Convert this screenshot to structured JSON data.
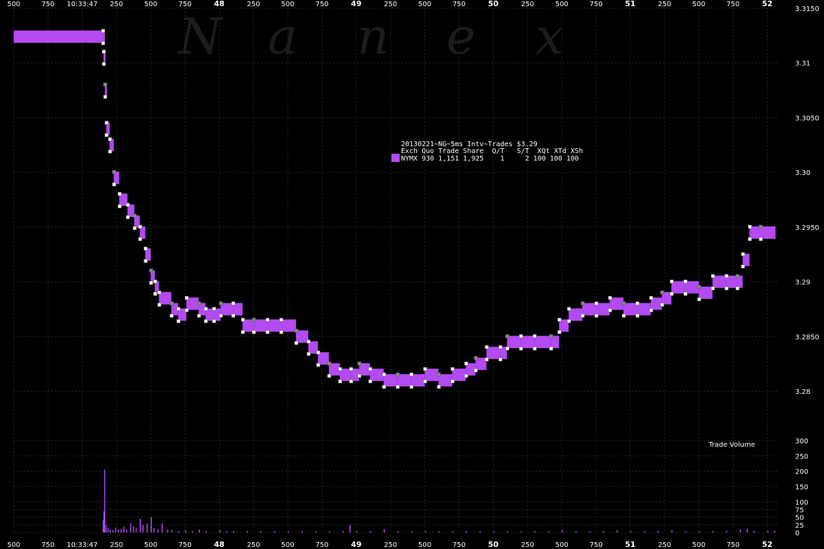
{
  "watermark": [
    "N",
    "a",
    "n",
    "e",
    "x"
  ],
  "legend": {
    "line1": "20130221~NG~5ms Intv~Trades $3.29",
    "line2": "Exch Quo Trade Share  Q/T   S/T  XQt XTd XSh",
    "line3": "NYMX 930 1,151 1,925    1     2 100 100 100"
  },
  "volume_title": "Trade Volume",
  "colors": {
    "background": "#000000",
    "series": "#b44af2",
    "grid": "#2a2a2a",
    "text": "#ffffff",
    "marker": "#ffffff",
    "marker_dark": "#888888"
  },
  "chart_data": {
    "type": "line",
    "title": "20130221~NG~5ms Intv~Trades $3.29",
    "xlabel": "",
    "ylabel": "",
    "x_unit": "ms from 10:33:47.000",
    "x_range": [
      -500,
      5088
    ],
    "x_ticks": [
      {
        "x": -500,
        "label": "500"
      },
      {
        "x": -250,
        "label": "750"
      },
      {
        "x": 0,
        "label": "10:33:47"
      },
      {
        "x": 250,
        "label": "250"
      },
      {
        "x": 500,
        "label": "500"
      },
      {
        "x": 750,
        "label": "750"
      },
      {
        "x": 1000,
        "label": "48"
      },
      {
        "x": 1250,
        "label": "250"
      },
      {
        "x": 1500,
        "label": "500"
      },
      {
        "x": 1750,
        "label": "750"
      },
      {
        "x": 2000,
        "label": "49"
      },
      {
        "x": 2250,
        "label": "250"
      },
      {
        "x": 2500,
        "label": "500"
      },
      {
        "x": 2750,
        "label": "750"
      },
      {
        "x": 3000,
        "label": "50"
      },
      {
        "x": 3250,
        "label": "250"
      },
      {
        "x": 3500,
        "label": "500"
      },
      {
        "x": 3750,
        "label": "750"
      },
      {
        "x": 4000,
        "label": "51"
      },
      {
        "x": 4250,
        "label": "250"
      },
      {
        "x": 4500,
        "label": "500"
      },
      {
        "x": 4750,
        "label": "750"
      },
      {
        "x": 5000,
        "label": "52"
      }
    ],
    "bold_x_ticks": [
      "48",
      "49",
      "50",
      "51",
      "52"
    ],
    "y_range": [
      3.2775,
      3.315
    ],
    "y_ticks": [
      {
        "y": 3.315,
        "label": "3.3150"
      },
      {
        "y": 3.31,
        "label": "3.31"
      },
      {
        "y": 3.305,
        "label": "3.3050"
      },
      {
        "y": 3.3,
        "label": "3.30"
      },
      {
        "y": 3.295,
        "label": "3.2950"
      },
      {
        "y": 3.29,
        "label": "3.29"
      },
      {
        "y": 3.285,
        "label": "3.2850"
      },
      {
        "y": 3.28,
        "label": "3.28"
      }
    ],
    "grid": true,
    "legend_position": "center",
    "series": [
      {
        "name": "NYMX",
        "values": [
          {
            "x": -500,
            "y": 3.3124
          },
          {
            "x": 150,
            "y": 3.3124
          },
          {
            "x": 155,
            "y": 3.3105
          },
          {
            "x": 165,
            "y": 3.3075
          },
          {
            "x": 175,
            "y": 3.304
          },
          {
            "x": 200,
            "y": 3.3025
          },
          {
            "x": 230,
            "y": 3.2995
          },
          {
            "x": 270,
            "y": 3.2975
          },
          {
            "x": 330,
            "y": 3.2965
          },
          {
            "x": 380,
            "y": 3.2955
          },
          {
            "x": 420,
            "y": 3.2945
          },
          {
            "x": 460,
            "y": 3.2925
          },
          {
            "x": 500,
            "y": 3.2905
          },
          {
            "x": 530,
            "y": 3.2895
          },
          {
            "x": 560,
            "y": 3.2885
          },
          {
            "x": 650,
            "y": 3.2875
          },
          {
            "x": 700,
            "y": 3.287
          },
          {
            "x": 760,
            "y": 3.288
          },
          {
            "x": 850,
            "y": 3.2875
          },
          {
            "x": 900,
            "y": 3.287
          },
          {
            "x": 960,
            "y": 3.287
          },
          {
            "x": 1010,
            "y": 3.2875
          },
          {
            "x": 1100,
            "y": 3.2875
          },
          {
            "x": 1170,
            "y": 3.286
          },
          {
            "x": 1250,
            "y": 3.286
          },
          {
            "x": 1350,
            "y": 3.286
          },
          {
            "x": 1450,
            "y": 3.286
          },
          {
            "x": 1560,
            "y": 3.285
          },
          {
            "x": 1650,
            "y": 3.284
          },
          {
            "x": 1720,
            "y": 3.283
          },
          {
            "x": 1800,
            "y": 3.282
          },
          {
            "x": 1880,
            "y": 3.2815
          },
          {
            "x": 1960,
            "y": 3.2815
          },
          {
            "x": 2020,
            "y": 3.282
          },
          {
            "x": 2100,
            "y": 3.2815
          },
          {
            "x": 2200,
            "y": 3.281
          },
          {
            "x": 2300,
            "y": 3.281
          },
          {
            "x": 2400,
            "y": 3.281
          },
          {
            "x": 2500,
            "y": 3.2815
          },
          {
            "x": 2600,
            "y": 3.281
          },
          {
            "x": 2700,
            "y": 3.2815
          },
          {
            "x": 2800,
            "y": 3.282
          },
          {
            "x": 2870,
            "y": 3.2825
          },
          {
            "x": 2950,
            "y": 3.2835
          },
          {
            "x": 3050,
            "y": 3.2835
          },
          {
            "x": 3100,
            "y": 3.2845
          },
          {
            "x": 3200,
            "y": 3.2845
          },
          {
            "x": 3300,
            "y": 3.2845
          },
          {
            "x": 3420,
            "y": 3.2845
          },
          {
            "x": 3480,
            "y": 3.286
          },
          {
            "x": 3550,
            "y": 3.287
          },
          {
            "x": 3650,
            "y": 3.2875
          },
          {
            "x": 3750,
            "y": 3.2875
          },
          {
            "x": 3850,
            "y": 3.288
          },
          {
            "x": 3950,
            "y": 3.2875
          },
          {
            "x": 4050,
            "y": 3.2875
          },
          {
            "x": 4150,
            "y": 3.288
          },
          {
            "x": 4230,
            "y": 3.2885
          },
          {
            "x": 4300,
            "y": 3.2895
          },
          {
            "x": 4400,
            "y": 3.2895
          },
          {
            "x": 4500,
            "y": 3.289
          },
          {
            "x": 4600,
            "y": 3.29
          },
          {
            "x": 4700,
            "y": 3.29
          },
          {
            "x": 4780,
            "y": 3.29
          },
          {
            "x": 4820,
            "y": 3.292
          },
          {
            "x": 4870,
            "y": 3.2945
          },
          {
            "x": 4950,
            "y": 3.2945
          },
          {
            "x": 5060,
            "y": 3.2945
          }
        ]
      }
    ],
    "volume": {
      "title": "Trade Volume",
      "y_range": [
        0,
        300
      ],
      "y_ticks": [
        {
          "y": 0,
          "label": "0"
        },
        {
          "y": 25,
          "label": "25"
        },
        {
          "y": 50,
          "label": "50"
        },
        {
          "y": 75,
          "label": "75"
        },
        {
          "y": 100,
          "label": "100"
        },
        {
          "y": 150,
          "label": "150"
        },
        {
          "y": 200,
          "label": "200"
        },
        {
          "y": 250,
          "label": "250"
        },
        {
          "y": 300,
          "label": "300"
        }
      ],
      "bars": [
        {
          "x": 150,
          "y": 40
        },
        {
          "x": 155,
          "y": 70
        },
        {
          "x": 160,
          "y": 205
        },
        {
          "x": 170,
          "y": 25
        },
        {
          "x": 185,
          "y": 15
        },
        {
          "x": 200,
          "y": 10
        },
        {
          "x": 220,
          "y": 8
        },
        {
          "x": 240,
          "y": 15
        },
        {
          "x": 260,
          "y": 10
        },
        {
          "x": 280,
          "y": 12
        },
        {
          "x": 300,
          "y": 20
        },
        {
          "x": 320,
          "y": 10
        },
        {
          "x": 350,
          "y": 30
        },
        {
          "x": 370,
          "y": 20
        },
        {
          "x": 390,
          "y": 15
        },
        {
          "x": 420,
          "y": 45
        },
        {
          "x": 440,
          "y": 25
        },
        {
          "x": 470,
          "y": 30
        },
        {
          "x": 500,
          "y": 50
        },
        {
          "x": 520,
          "y": 15
        },
        {
          "x": 550,
          "y": 10
        },
        {
          "x": 580,
          "y": 30
        },
        {
          "x": 620,
          "y": 10
        },
        {
          "x": 650,
          "y": 8
        },
        {
          "x": 700,
          "y": 5
        },
        {
          "x": 750,
          "y": 8
        },
        {
          "x": 800,
          "y": 5
        },
        {
          "x": 850,
          "y": 10
        },
        {
          "x": 900,
          "y": 5
        },
        {
          "x": 1000,
          "y": 8
        },
        {
          "x": 1050,
          "y": 5
        },
        {
          "x": 1100,
          "y": 5
        },
        {
          "x": 1200,
          "y": 5
        },
        {
          "x": 1300,
          "y": 5
        },
        {
          "x": 1400,
          "y": 5
        },
        {
          "x": 1500,
          "y": 4
        },
        {
          "x": 1600,
          "y": 5
        },
        {
          "x": 1700,
          "y": 5
        },
        {
          "x": 1800,
          "y": 4
        },
        {
          "x": 1900,
          "y": 5
        },
        {
          "x": 1950,
          "y": 25
        },
        {
          "x": 2000,
          "y": 5
        },
        {
          "x": 2100,
          "y": 5
        },
        {
          "x": 2200,
          "y": 12
        },
        {
          "x": 2300,
          "y": 5
        },
        {
          "x": 2400,
          "y": 4
        },
        {
          "x": 2500,
          "y": 5
        },
        {
          "x": 2600,
          "y": 4
        },
        {
          "x": 2700,
          "y": 4
        },
        {
          "x": 2800,
          "y": 5
        },
        {
          "x": 2900,
          "y": 4
        },
        {
          "x": 3000,
          "y": 4
        },
        {
          "x": 3100,
          "y": 4
        },
        {
          "x": 3200,
          "y": 4
        },
        {
          "x": 3300,
          "y": 5
        },
        {
          "x": 3400,
          "y": 4
        },
        {
          "x": 3500,
          "y": 8
        },
        {
          "x": 3600,
          "y": 5
        },
        {
          "x": 3700,
          "y": 4
        },
        {
          "x": 3800,
          "y": 5
        },
        {
          "x": 3900,
          "y": 8
        },
        {
          "x": 4000,
          "y": 5
        },
        {
          "x": 4100,
          "y": 5
        },
        {
          "x": 4200,
          "y": 6
        },
        {
          "x": 4300,
          "y": 8
        },
        {
          "x": 4400,
          "y": 5
        },
        {
          "x": 4500,
          "y": 5
        },
        {
          "x": 4600,
          "y": 5
        },
        {
          "x": 4700,
          "y": 6
        },
        {
          "x": 4800,
          "y": 10
        },
        {
          "x": 4850,
          "y": 12
        },
        {
          "x": 4900,
          "y": 6
        },
        {
          "x": 5000,
          "y": 5
        },
        {
          "x": 5050,
          "y": 6
        }
      ]
    }
  }
}
